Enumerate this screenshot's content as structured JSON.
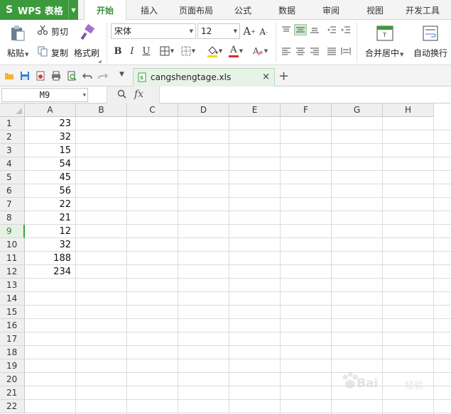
{
  "app": {
    "name": "WPS 表格",
    "logo_glyph": "S",
    "accent_color": "#3c9a3c"
  },
  "menu": {
    "tabs": [
      "开始",
      "插入",
      "页面布局",
      "公式",
      "数据",
      "审阅",
      "视图",
      "开发工具"
    ],
    "active_tab": "开始"
  },
  "ribbon": {
    "paste_label": "粘贴",
    "cut_label": "剪切",
    "copy_label": "复制",
    "format_painter_label": "格式刷",
    "font_name": "宋体",
    "font_size": "12",
    "bold_label": "B",
    "italic_label": "I",
    "underline_label": "U",
    "increase_font_label": "A",
    "decrease_font_label": "A",
    "font_color_label": "A",
    "merge_center_label": "合并居中",
    "wrap_text_label": "自动换行"
  },
  "file_tab": {
    "filename": "cangshengtage.xls",
    "close_glyph": "×",
    "new_tab_glyph": "+"
  },
  "formula_bar": {
    "cell_ref": "M9",
    "fx_label": "fx",
    "zoom_glyph": "🔍",
    "formula_value": ""
  },
  "grid": {
    "columns": [
      "A",
      "B",
      "C",
      "D",
      "E",
      "F",
      "G",
      "H"
    ],
    "rows": [
      "1",
      "2",
      "3",
      "4",
      "5",
      "6",
      "7",
      "8",
      "9",
      "10",
      "11",
      "12",
      "13",
      "14",
      "15",
      "16",
      "17",
      "18",
      "19",
      "20",
      "21",
      "22"
    ],
    "selected_row": "9",
    "column_a_values": [
      "23",
      "32",
      "15",
      "54",
      "45",
      "56",
      "22",
      "21",
      "12",
      "32",
      "188",
      "234"
    ]
  },
  "watermark": {
    "text": "Bai",
    "sub": "经验"
  }
}
